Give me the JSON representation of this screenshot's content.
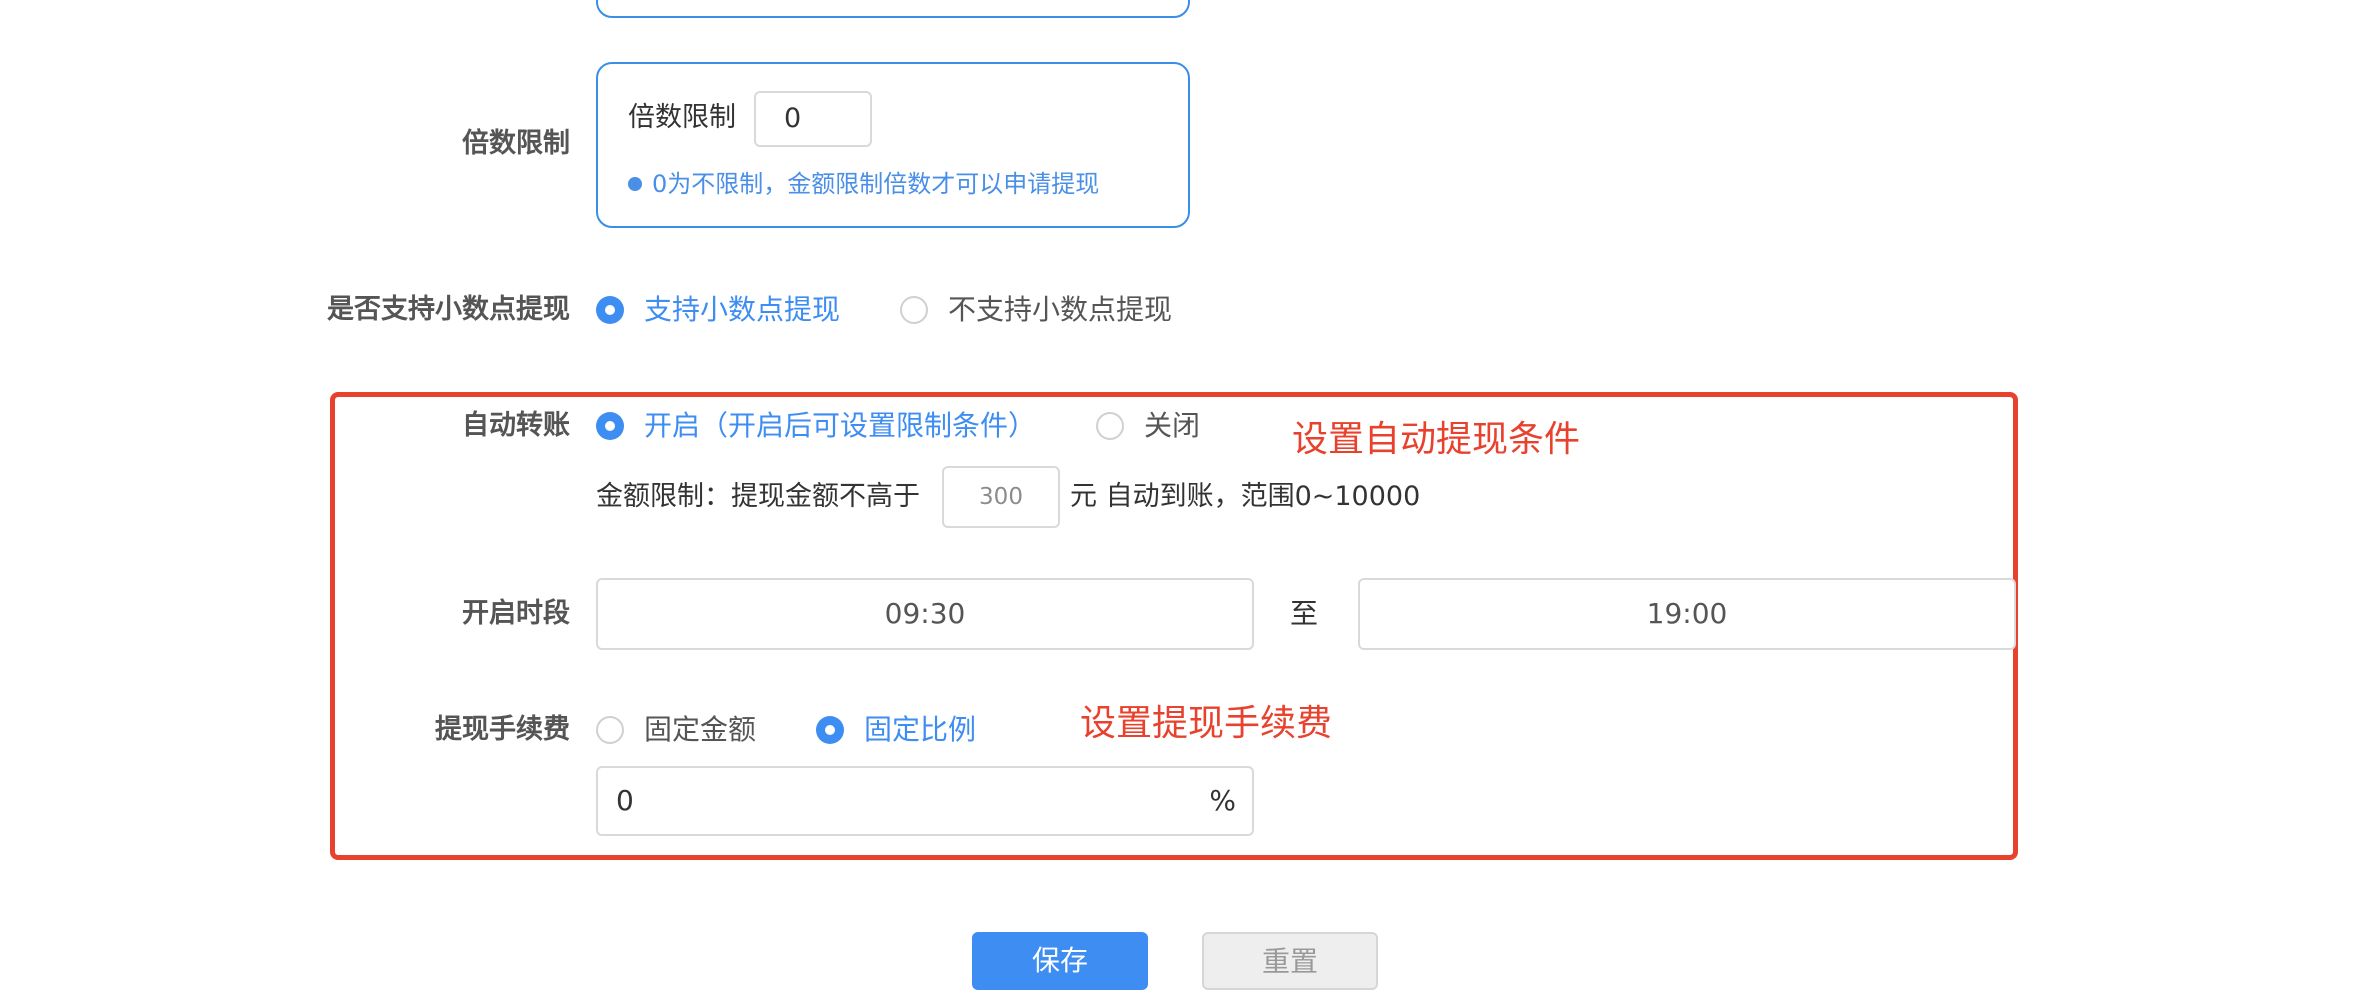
{
  "multiplier": {
    "row_label": "倍数限制",
    "inner_label": "倍数限制",
    "value": "0",
    "hint": "0为不限制，金额限制倍数才可以申请提现"
  },
  "decimal": {
    "row_label": "是否支持小数点提现",
    "options": [
      "支持小数点提现",
      "不支持小数点提现"
    ],
    "selected": "支持小数点提现"
  },
  "auto_transfer": {
    "row_label": "自动转账",
    "options": [
      "开启（开启后可设置限制条件）",
      "关闭"
    ],
    "selected": "开启（开启后可设置限制条件）",
    "amount_label": "金额限制：提现金额不高于",
    "amount_value": "300",
    "amount_suffix": "元 自动到账，范围0~10000",
    "annotation": "设置自动提现条件"
  },
  "time_period": {
    "row_label": "开启时段",
    "start": "09:30",
    "separator": "至",
    "end": "19:00"
  },
  "fee": {
    "row_label": "提现手续费",
    "options": [
      "固定金额",
      "固定比例"
    ],
    "selected": "固定比例",
    "value": "0",
    "suffix": "%",
    "annotation": "设置提现手续费"
  },
  "actions": {
    "save": "保存",
    "reset": "重置"
  },
  "colors": {
    "primary": "#3d8df2",
    "annotation": "#e8412d",
    "box_border": "#3a8ee6"
  }
}
